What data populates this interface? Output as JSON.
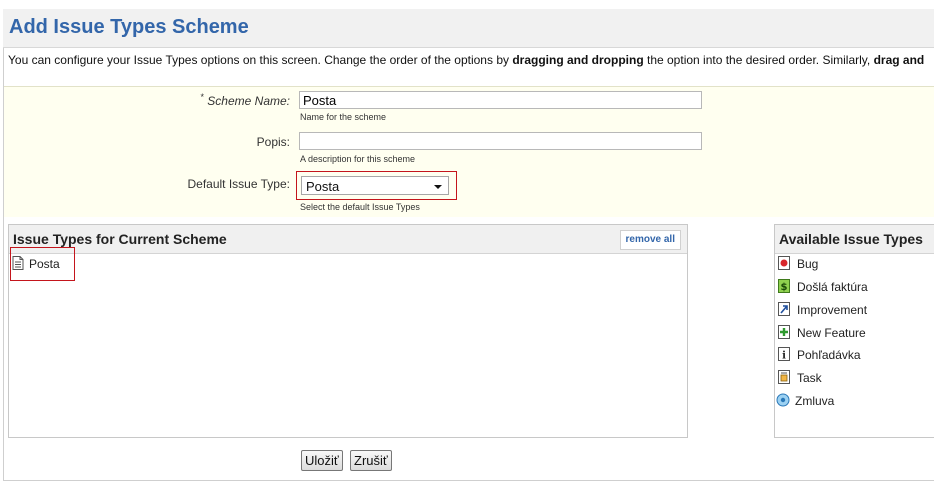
{
  "page": {
    "title": "Add Issue Types Scheme",
    "description_prefix": "You can configure your Issue Types options on this screen. Change the order of the options by ",
    "description_bold1": "dragging and dropping",
    "description_mid": " the option into the desired order. Similarly, ",
    "description_bold2": "drag and"
  },
  "form": {
    "scheme_name_label": "Scheme Name:",
    "scheme_name_required": "*",
    "scheme_name_value": "Posta",
    "scheme_name_hint": "Name for the scheme",
    "popis_label": "Popis:",
    "popis_value": "",
    "popis_hint": "A description for this scheme",
    "default_type_label": "Default Issue Type:",
    "default_type_value": "Posta",
    "default_type_hint": "Select the default Issue Types"
  },
  "current_scheme": {
    "title": "Issue Types for Current Scheme",
    "remove_all": "remove all",
    "items": [
      {
        "label": "Posta",
        "icon": "document-icon"
      }
    ]
  },
  "available": {
    "title": "Available Issue Types",
    "items": [
      {
        "label": "Bug",
        "icon": "bug-icon"
      },
      {
        "label": "Došlá faktúra",
        "icon": "invoice-icon"
      },
      {
        "label": "Improvement",
        "icon": "improvement-icon"
      },
      {
        "label": "New Feature",
        "icon": "new-feature-icon"
      },
      {
        "label": "Pohľadávka",
        "icon": "info-icon"
      },
      {
        "label": "Task",
        "icon": "task-icon"
      },
      {
        "label": "Zmluva",
        "icon": "contract-icon"
      }
    ]
  },
  "buttons": {
    "save": "Uložiť",
    "cancel": "Zrušiť"
  },
  "colors": {
    "title": "#3366aa",
    "highlight": "#c4151c",
    "form_bg": "#fffff0"
  }
}
